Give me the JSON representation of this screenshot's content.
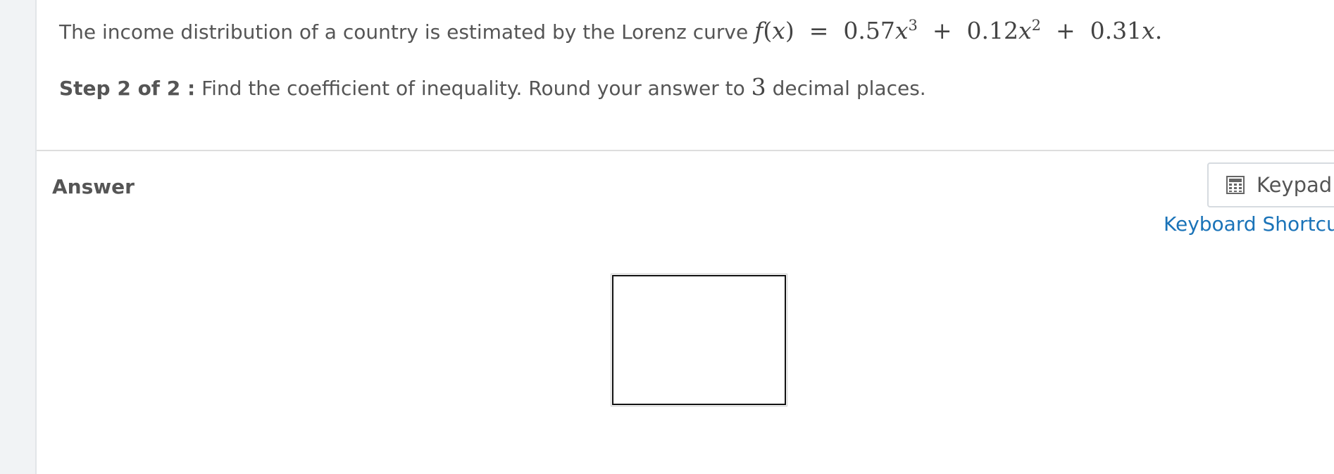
{
  "question": {
    "text": "The income distribution of a country is estimated by the Lorenz curve",
    "equation": {
      "f": "f",
      "open_paren": "(",
      "var": "x",
      "close_paren": ")",
      "equals": "=",
      "c1": "0.57",
      "x1": "x",
      "p1": "3",
      "plus1": "+",
      "c2": "0.12",
      "x2": "x",
      "p2": "2",
      "plus2": "+",
      "c3": "0.31",
      "x3": "x",
      "period": "."
    }
  },
  "step": {
    "label": "Step 2 of 2 :",
    "text_before": "Find the coefficient of inequality. Round your answer to",
    "decimals": "3",
    "text_after": "decimal places."
  },
  "answer": {
    "heading": "Answer",
    "input_value": ""
  },
  "keypad": {
    "icon": "calculator-icon",
    "label": "Keypad"
  },
  "shortcuts": {
    "label": "Keyboard Shortcut"
  },
  "colors": {
    "link": "#1a73b8",
    "text": "#555555",
    "gutter": "#f1f3f5"
  }
}
